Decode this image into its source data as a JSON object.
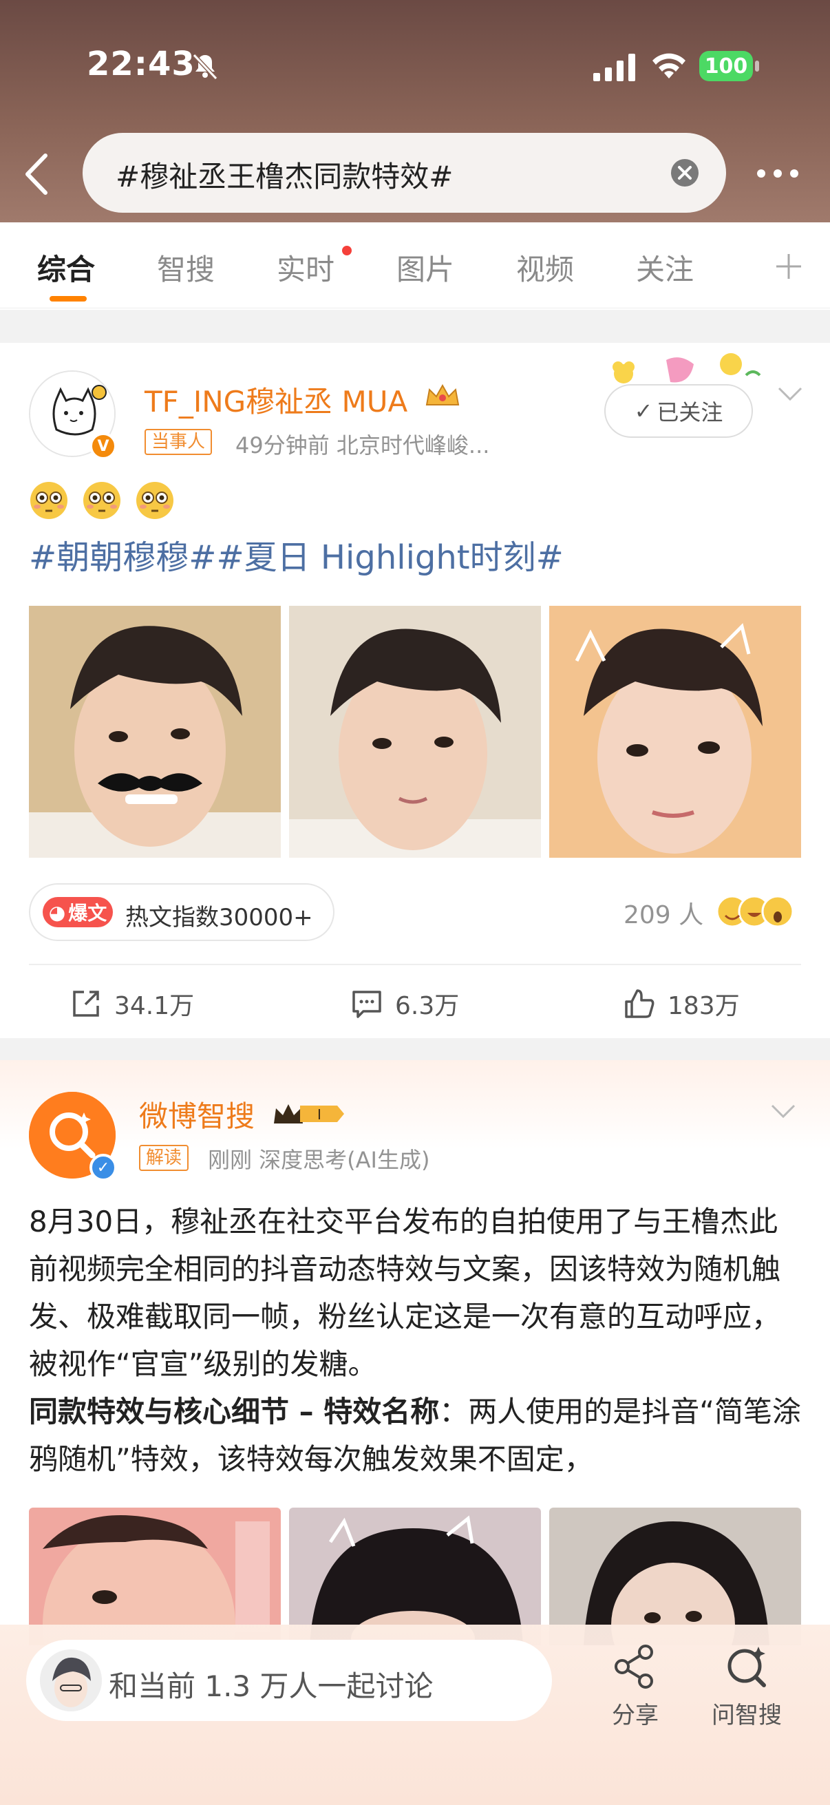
{
  "status_bar": {
    "time": "22:43",
    "battery": "100"
  },
  "search": {
    "query": "#穆祉丞王橹杰同款特效#"
  },
  "tabs": [
    "综合",
    "智搜",
    "实时",
    "图片",
    "视频",
    "关注"
  ],
  "post1": {
    "user": "TF_ING穆祉丞 MUA",
    "tag": "当事人",
    "meta": "49分钟前  北京时代峰峻...",
    "follow_label": "已关注",
    "hashtags": "#朝朝穆穆##夏日 Highlight时刻#",
    "hot_badge": "爆文",
    "hot_text": "热文指数30000+",
    "reaction_count": "209 人",
    "actions": {
      "repost": "34.1万",
      "comment": "6.3万",
      "like": "183万"
    }
  },
  "post2": {
    "user": "微博智搜",
    "tag": "解读",
    "meta": "刚刚 深度思考(AI生成)",
    "paragraph1": "8月30日，穆祉丞在社交平台发布的自拍使用了与王橹杰此前视频完全相同的抖音动态特效与文案，因该特效为随机触发、极难截取同一帧，粉丝认定这是一次有意的互动呼应，被视作“官宣”级别的发糖。",
    "bold_lead": "同款特效与核心细节 – 特效名称",
    "paragraph2": "：两人使用的是抖音“简笔涂鸦随机”特效，该特效每次触发效果不固定，"
  },
  "bottom_bar": {
    "discuss": "和当前 1.3 万人一起讨论",
    "share": "分享",
    "ask": "问智搜"
  },
  "colors": {
    "accent": "#ff8200",
    "brand_orange": "#ee7b1b",
    "link_blue": "#4d6fa3"
  }
}
